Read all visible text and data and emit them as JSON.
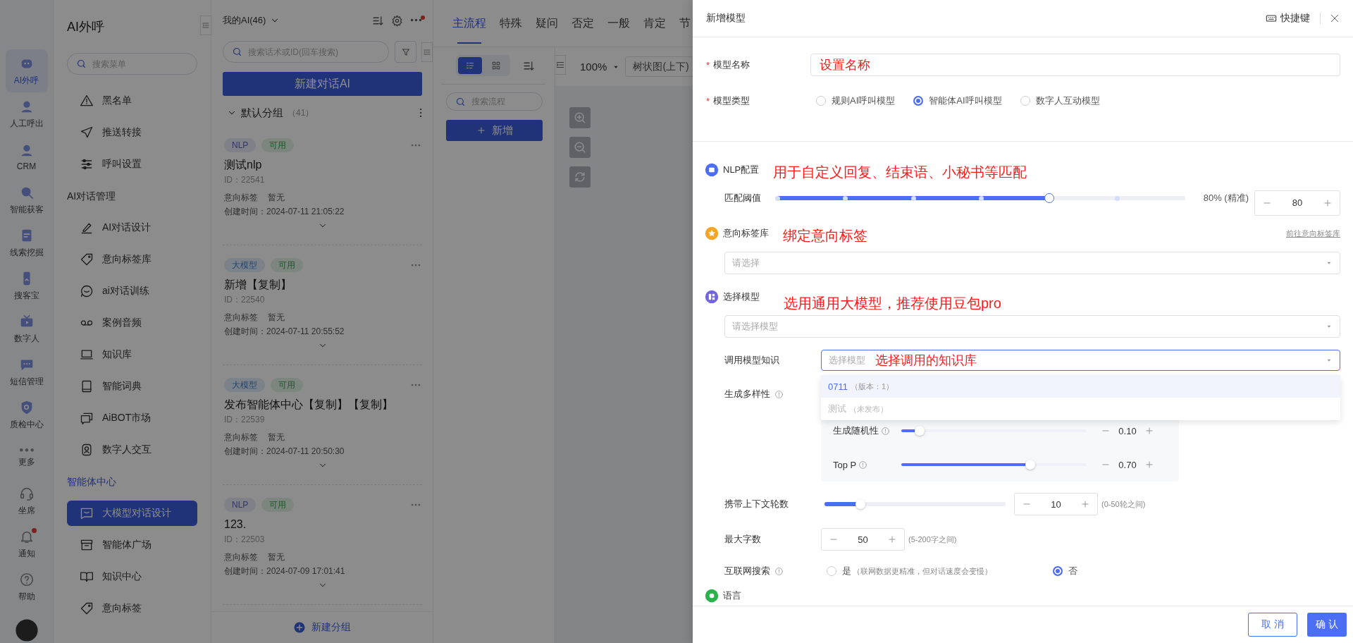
{
  "rail": {
    "items": [
      {
        "label": "AI外呼",
        "selected": true,
        "unread": false
      },
      {
        "label": "人工呼出",
        "selected": false,
        "unread": false
      },
      {
        "label": "CRM",
        "selected": false,
        "unread": false
      },
      {
        "label": "智能获客",
        "selected": false,
        "unread": false
      },
      {
        "label": "线索挖掘",
        "selected": false,
        "unread": false
      },
      {
        "label": "搜客宝",
        "selected": false,
        "unread": false
      },
      {
        "label": "数字人",
        "selected": false,
        "unread": false
      },
      {
        "label": "短信管理",
        "selected": false,
        "unread": false
      },
      {
        "label": "质检中心",
        "selected": false,
        "unread": false
      },
      {
        "label": "更多",
        "selected": false,
        "unread": false
      },
      {
        "label": "坐席",
        "selected": false,
        "unread": false
      },
      {
        "label": "通知",
        "selected": false,
        "unread": true
      },
      {
        "label": "帮助",
        "selected": false,
        "unread": false
      }
    ]
  },
  "menu": {
    "title": "AI外呼",
    "search": {
      "placeholder": "搜索菜单"
    },
    "groups": [
      {
        "items": [
          {
            "label": "黑名单",
            "selected": false
          },
          {
            "label": "推送转接",
            "selected": false
          },
          {
            "label": "呼叫设置",
            "selected": false
          }
        ]
      },
      {
        "heading": "AI对话管理",
        "items": [
          {
            "label": "AI对话设计",
            "selected": false
          },
          {
            "label": "意向标签库",
            "selected": false
          },
          {
            "label": "ai对话训练",
            "selected": false
          },
          {
            "label": "案例音频",
            "selected": false
          },
          {
            "label": "知识库",
            "selected": false
          },
          {
            "label": "智能词典",
            "selected": false
          },
          {
            "label": "AiBOT市场",
            "selected": false
          },
          {
            "label": "数字人交互",
            "selected": false
          }
        ]
      },
      {
        "heading": "智能体中心",
        "items": [
          {
            "label": "大模型对话设计",
            "selected": true
          },
          {
            "label": "智能体广场",
            "selected": false
          },
          {
            "label": "知识中心",
            "selected": false
          },
          {
            "label": "意向标签",
            "selected": false
          }
        ]
      }
    ]
  },
  "ai_list": {
    "title": "我的AI(46)",
    "notice": true,
    "search": {
      "placeholder": "搜索话术或ID(回车搜索)"
    },
    "new_button": "新建对话AI",
    "group": {
      "name": "默认分组",
      "count": "（41）",
      "expanded": true,
      "cards": [
        {
          "tags": [
            {
              "label": "NLP",
              "kind": "nlp"
            },
            {
              "label": "可用",
              "kind": "status"
            }
          ],
          "title": "测试nlp",
          "id": "ID：22541",
          "intent_label": "意向标签",
          "intent_value": "暂无",
          "created": "创建时间：2024-07-11 21:05:22"
        },
        {
          "tags": [
            {
              "label": "大模型",
              "kind": "llm"
            },
            {
              "label": "可用",
              "kind": "status"
            }
          ],
          "title": "新增【复制】",
          "id": "ID：22540",
          "intent_label": "意向标签",
          "intent_value": "暂无",
          "created": "创建时间：2024-07-11 20:55:52"
        },
        {
          "tags": [
            {
              "label": "大模型",
              "kind": "llm"
            },
            {
              "label": "可用",
              "kind": "status"
            }
          ],
          "title": "发布智能体中心【复制】【复制】",
          "id": "ID：22539",
          "intent_label": "意向标签",
          "intent_value": "暂无",
          "created": "创建时间：2024-07-11 20:50:30"
        },
        {
          "tags": [
            {
              "label": "NLP",
              "kind": "nlp"
            },
            {
              "label": "可用",
              "kind": "status"
            }
          ],
          "title": "123.",
          "id": "ID：22503",
          "intent_label": "意向标签",
          "intent_value": "暂无",
          "created": "创建时间：2024-07-09 17:01:41"
        }
      ]
    },
    "footer_button": "新建分组"
  },
  "flow": {
    "tabs": [
      {
        "label": "主流程",
        "selected": true
      },
      {
        "label": "特殊",
        "selected": false
      },
      {
        "label": "疑问",
        "selected": false
      },
      {
        "label": "否定",
        "selected": false
      },
      {
        "label": "一般",
        "selected": false
      },
      {
        "label": "肯定",
        "selected": false
      },
      {
        "label": "节",
        "selected": false
      }
    ],
    "view_modes": [
      {
        "kind": "list",
        "selected": true
      },
      {
        "kind": "grid",
        "selected": false
      }
    ],
    "search": {
      "placeholder": "搜索流程"
    },
    "add_button": "新增",
    "zoom": "100%",
    "layout_select": "树状图(上下)"
  },
  "drawer": {
    "title": "新增模型",
    "shortcut": "快捷键",
    "name_field": {
      "mark": "*",
      "label": "模型名称",
      "annotation": "设置名称"
    },
    "type_field": {
      "mark": "*",
      "label": "模型类型",
      "options": [
        {
          "label": "规则AI呼叫模型",
          "selected": false
        },
        {
          "label": "智能体AI呼叫模型",
          "selected": true
        },
        {
          "label": "数字人互动模型",
          "selected": false
        }
      ]
    },
    "sections": [
      {
        "kind": "nlp",
        "title": "NLP配置",
        "color": "#4c6ef5",
        "annotation": "用于自定义回复、结束语、小秘书等匹配",
        "threshold": {
          "label": "匹配阈值",
          "level": 0.667,
          "reading": "80% (精准)",
          "value": "80"
        }
      },
      {
        "kind": "intent",
        "title": "意向标签库",
        "color": "#f5a524",
        "annotation": "绑定意向标签",
        "link": "前往意向标签库",
        "placeholder": "请选择"
      },
      {
        "kind": "model",
        "title": "选择模型",
        "color": "#7165e3",
        "annotation": "选用通用大模型，推荐使用豆包pro",
        "placeholder": "请选择模型",
        "knowledge": {
          "label": "调用模型知识",
          "placeholder": "选择模型",
          "annotation": "选择调用的知识库",
          "expanded": true,
          "options": [
            {
              "label": "0711",
              "note": "（版本：1）",
              "selected": true,
              "disabled": false
            },
            {
              "label": "测试",
              "note": "（未发布）",
              "selected": false,
              "disabled": true
            }
          ]
        },
        "diversity": {
          "label": "生成多样性",
          "info": true,
          "sliders": [
            {
              "label": "生成随机性",
              "info": true,
              "level": 0.1,
              "value": "0.10"
            },
            {
              "label": "Top P",
              "info": true,
              "level": 0.7,
              "value": "0.70"
            }
          ]
        },
        "context": {
          "label": "携带上下文轮数",
          "level": 0.2,
          "value": "10",
          "hint": "(0-50轮之间)"
        },
        "max_chars": {
          "label": "最大字数",
          "value": "50",
          "hint": "(5-200字之间)"
        },
        "web_search": {
          "label": "互联网搜索",
          "info": true,
          "options": [
            {
              "label": "是",
              "note": "（联网数据更精准，但对话速度会变慢）",
              "selected": false
            },
            {
              "label": "否",
              "selected": true
            }
          ]
        }
      },
      {
        "kind": "language",
        "title": "语言",
        "color": "#2bb24c"
      }
    ],
    "cancel": "取 消",
    "confirm": "确 认"
  }
}
